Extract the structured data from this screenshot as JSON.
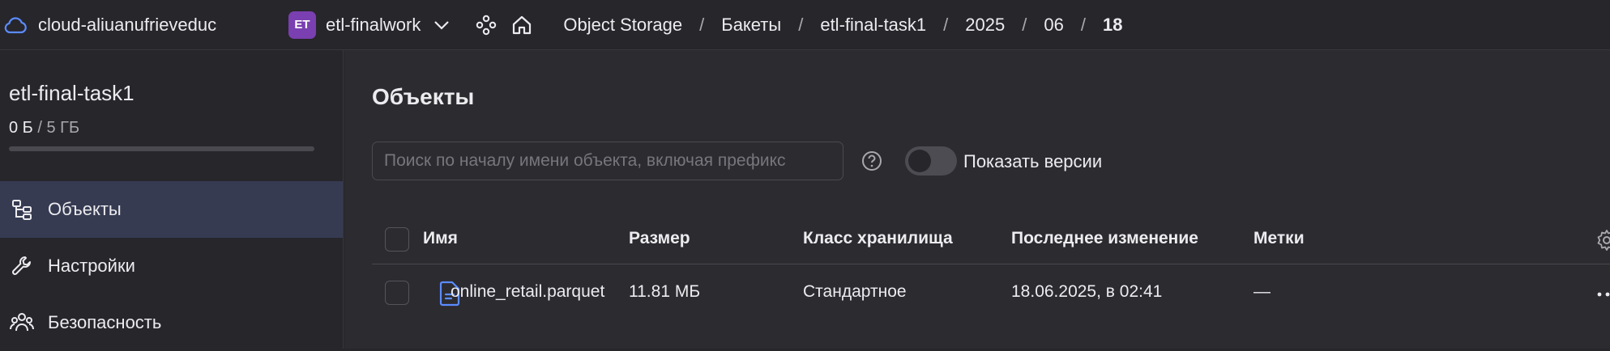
{
  "topbar": {
    "cloud_name": "cloud-aliuanufrieveduc",
    "folder_badge": "ET",
    "folder_name": "etl-finalwork",
    "breadcrumbs": [
      "Object Storage",
      "Бакеты",
      "etl-final-task1",
      "2025",
      "06",
      "18"
    ],
    "separator": "/"
  },
  "sidebar": {
    "bucket_name": "etl-final-task1",
    "usage_used": "0 Б",
    "usage_sep": " / ",
    "usage_total": "5 ГБ",
    "usage_fraction": 0,
    "items": [
      {
        "label": "Объекты",
        "icon": "objects-tree-icon",
        "active": true
      },
      {
        "label": "Настройки",
        "icon": "wrench-icon",
        "active": false
      },
      {
        "label": "Безопасность",
        "icon": "users-security-icon",
        "active": false
      }
    ]
  },
  "main": {
    "title": "Объекты",
    "search_placeholder": "Поиск по началу имени объекта, включая префикс",
    "search_value": "",
    "show_versions_label": "Показать версии",
    "show_versions_on": false,
    "columns": [
      "Имя",
      "Размер",
      "Класс хранилища",
      "Последнее изменение",
      "Метки"
    ],
    "rows": [
      {
        "name": "online_retail.parquet",
        "size": "11.81 МБ",
        "storage_class": "Стандартное",
        "modified": "18.06.2025, в 02:41",
        "tags": "—"
      }
    ]
  },
  "colors": {
    "background": "#27262b",
    "main_background": "#2c2b30",
    "active_nav": "#363b52",
    "accent_blue": "#4a90ff",
    "folder_badge": "#7a3fb0"
  }
}
